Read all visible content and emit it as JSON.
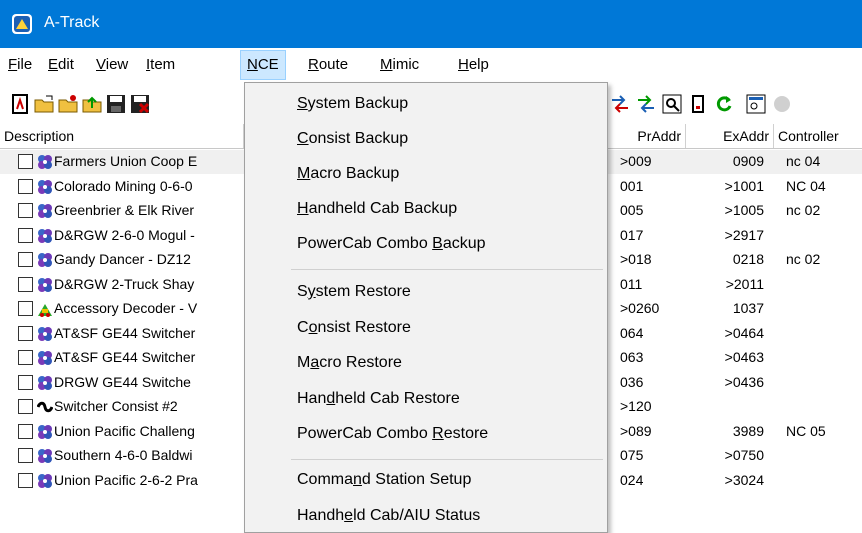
{
  "window": {
    "title": "A-Track"
  },
  "menu": [
    "File",
    "Edit",
    "View",
    "Item",
    "NCE",
    "Route",
    "Mimic",
    "Help"
  ],
  "columns": {
    "description": "Description",
    "praddr": "PrAddr",
    "exaddr": "ExAddr",
    "controller": "Controller"
  },
  "rows": [
    {
      "desc": "Farmers Union Coop E",
      "pr": ">009",
      "ex": "0909",
      "ctl": "nc 04",
      "icon": "locomotive-icon",
      "selected": true
    },
    {
      "desc": "Colorado Mining 0-6-0",
      "pr": "001",
      "ex": ">1001",
      "ctl": "NC 04",
      "icon": "locomotive-icon"
    },
    {
      "desc": "Greenbrier & Elk River",
      "pr": "005",
      "ex": ">1005",
      "ctl": "nc 02",
      "icon": "locomotive-icon"
    },
    {
      "desc": "D&RGW 2-6-0 Mogul -",
      "pr": "017",
      "ex": ">2917",
      "ctl": "",
      "icon": "locomotive-icon"
    },
    {
      "desc": "Gandy Dancer - DZ12",
      "pr": ">018",
      "ex": "0218",
      "ctl": "nc 02",
      "icon": "locomotive-icon"
    },
    {
      "desc": "D&RGW 2-Truck Shay",
      "pr": "011",
      "ex": ">2011",
      "ctl": "",
      "icon": "locomotive-icon"
    },
    {
      "desc": "Accessory Decoder - V",
      "pr": ">0260",
      "ex": "1037",
      "ctl": "",
      "icon": "accessory-decoder-icon"
    },
    {
      "desc": "AT&SF GE44 Switcher",
      "pr": "064",
      "ex": ">0464",
      "ctl": "",
      "icon": "locomotive-icon"
    },
    {
      "desc": "AT&SF GE44 Switcher",
      "pr": "063",
      "ex": ">0463",
      "ctl": "",
      "icon": "locomotive-icon"
    },
    {
      "desc": "DRGW GE44 Switche",
      "pr": "036",
      "ex": ">0436",
      "ctl": "",
      "icon": "locomotive-icon"
    },
    {
      "desc": "Switcher Consist #2",
      "pr": ">120",
      "ex": "",
      "ctl": "",
      "icon": "consist-icon"
    },
    {
      "desc": "Union Pacific Challeng",
      "pr": ">089",
      "ex": "3989",
      "ctl": "NC 05",
      "icon": "locomotive-icon"
    },
    {
      "desc": "Southern 4-6-0 Baldwi",
      "pr": "075",
      "ex": ">0750",
      "ctl": "",
      "icon": "locomotive-icon"
    },
    {
      "desc": "Union Pacific 2-6-2 Pra",
      "pr": "024",
      "ex": ">3024",
      "ctl": "",
      "icon": "locomotive-icon"
    }
  ],
  "nce_menu": {
    "backup": [
      {
        "pre": "",
        "u": "S",
        "post": "ystem Backup"
      },
      {
        "pre": "",
        "u": "C",
        "post": "onsist Backup"
      },
      {
        "pre": "",
        "u": "M",
        "post": "acro Backup"
      },
      {
        "pre": "",
        "u": "H",
        "post": "andheld Cab Backup"
      },
      {
        "pre": "PowerCab Combo ",
        "u": "B",
        "post": "ackup"
      }
    ],
    "restore": [
      {
        "pre": "S",
        "u": "y",
        "post": "stem Restore"
      },
      {
        "pre": "C",
        "u": "o",
        "post": "nsist Restore"
      },
      {
        "pre": "M",
        "u": "a",
        "post": "cro Restore"
      },
      {
        "pre": "Han",
        "u": "d",
        "post": "held Cab Restore"
      },
      {
        "pre": "PowerCab Combo ",
        "u": "R",
        "post": "estore"
      }
    ],
    "other": [
      {
        "pre": "Comma",
        "u": "n",
        "post": "d Station Setup"
      },
      {
        "pre": "Handh",
        "u": "e",
        "post": "ld Cab/AIU Status"
      }
    ]
  },
  "colors": {
    "titlebar": "#0078d7",
    "menu_highlight": "#cce8ff",
    "dropdown_bg": "#f2f2f2"
  }
}
